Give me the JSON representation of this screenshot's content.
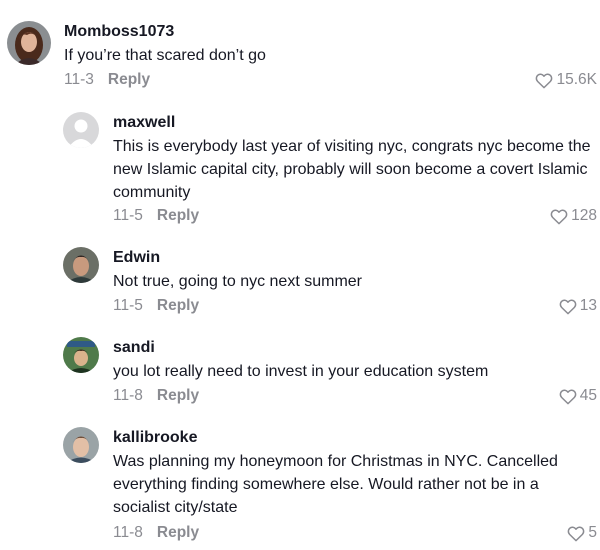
{
  "comments": [
    {
      "username": "Momboss1073",
      "text": "If you’re that scared don’t go",
      "date": "11-3",
      "reply_label": "Reply",
      "likes": "15.6K",
      "avatar_icon": "woman-with-brown-hair-avatar"
    },
    {
      "username": "maxwell",
      "text": "This is everybody last year of visiting nyc, congrats nyc become the new Islamic capital city, probably will soon become a covert Islamic community",
      "date": "11-5",
      "reply_label": "Reply",
      "likes": "128",
      "avatar_icon": "default-gray-avatar"
    },
    {
      "username": "Edwin",
      "text": "Not true, going to nyc next summer",
      "date": "11-5",
      "reply_label": "Reply",
      "likes": "13",
      "avatar_icon": "man-portrait-avatar"
    },
    {
      "username": "sandi",
      "text": "you lot really need to invest in your education system",
      "date": "11-8",
      "reply_label": "Reply",
      "likes": "45",
      "avatar_icon": "illustrated-green-avatar"
    },
    {
      "username": "kallibrooke",
      "text": "Was planning my honeymoon for Christmas in NYC. Cancelled everything finding somewhere else. Would rather not be in a socialist city/state",
      "date": "11-8",
      "reply_label": "Reply",
      "likes": "5",
      "avatar_icon": "young-man-portrait-avatar"
    }
  ],
  "colors": {
    "text": "#161823",
    "secondary": "#8a8b91"
  }
}
